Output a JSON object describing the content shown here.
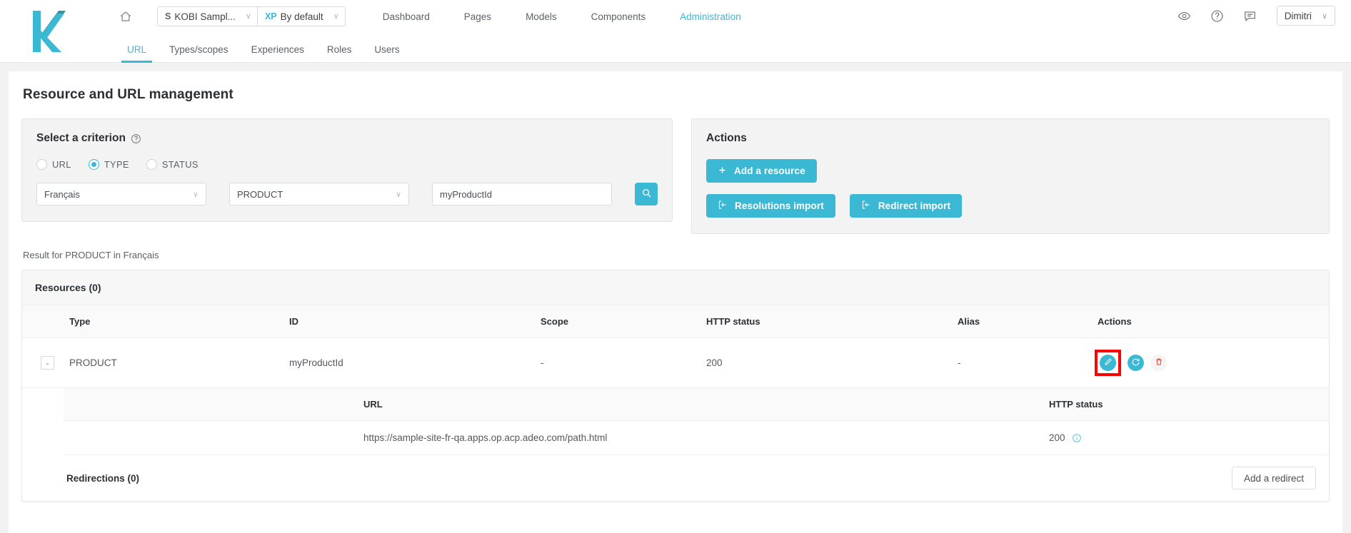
{
  "brand": {
    "logo_letter": "k",
    "accent": "#3bb9d4",
    "danger": "#f0372b"
  },
  "topbar": {
    "home_icon": "home-icon",
    "site_selector": {
      "tag": "S",
      "label": "KOBI Sampl...",
      "caret": "∨"
    },
    "experience_selector": {
      "tag": "XP",
      "label": "By default",
      "caret": "∨"
    },
    "nav": [
      {
        "label": "Dashboard",
        "active": false
      },
      {
        "label": "Pages",
        "active": false
      },
      {
        "label": "Models",
        "active": false
      },
      {
        "label": "Components",
        "active": false
      },
      {
        "label": "Administration",
        "active": true
      }
    ],
    "icons": [
      {
        "name": "eye-icon"
      },
      {
        "name": "help-circle-icon"
      },
      {
        "name": "feedback-icon"
      }
    ],
    "user": {
      "name": "Dimitri",
      "caret": "∨"
    }
  },
  "subnav": [
    {
      "label": "URL",
      "active": true
    },
    {
      "label": "Types/scopes",
      "active": false
    },
    {
      "label": "Experiences",
      "active": false
    },
    {
      "label": "Roles",
      "active": false
    },
    {
      "label": "Users",
      "active": false
    }
  ],
  "page": {
    "title": "Resource and URL management"
  },
  "criterion": {
    "heading": "Select a criterion",
    "help_icon": "help-circle-icon",
    "radios": [
      {
        "label": "URL",
        "checked": false
      },
      {
        "label": "TYPE",
        "checked": true
      },
      {
        "label": "STATUS",
        "checked": false
      }
    ],
    "language_select": {
      "value": "Français",
      "caret": "∨"
    },
    "type_select": {
      "value": "PRODUCT",
      "caret": "∨"
    },
    "id_input": {
      "value": "myProductId",
      "placeholder": "myProductId"
    },
    "search_button": {
      "icon": "search-icon",
      "label": ""
    }
  },
  "actions": {
    "heading": "Actions",
    "add_resource": {
      "label": "Add a resource",
      "icon": "plus-icon"
    },
    "resolutions_import": {
      "label": "Resolutions import",
      "icon": "import-icon"
    },
    "redirect_import": {
      "label": "Redirect import",
      "icon": "import-icon"
    }
  },
  "result": {
    "summary": "Result for PRODUCT in Français",
    "resources_heading": "Resources (0)",
    "columns": [
      "Type",
      "ID",
      "Scope",
      "HTTP status",
      "Alias",
      "Actions"
    ],
    "rows": [
      {
        "toggle": "-",
        "type": "PRODUCT",
        "id": "myProductId",
        "scope": "-",
        "http_status": "200",
        "alias": "-",
        "actions": [
          {
            "name": "edit-resource-button",
            "icon": "pencil-icon",
            "highlighted": true
          },
          {
            "name": "refresh-resource-button",
            "icon": "refresh-icon",
            "highlighted": false
          },
          {
            "name": "delete-resource-button",
            "icon": "trash-icon",
            "highlighted": false
          }
        ]
      }
    ],
    "url_table": {
      "columns": [
        "URL",
        "HTTP status"
      ],
      "rows": [
        {
          "url": "https://sample-site-fr-qa.apps.op.acp.adeo.com/path.html",
          "http_status": "200",
          "info_icon": "info-icon"
        }
      ]
    },
    "redirections": {
      "heading": "Redirections (0)",
      "add_button": "Add a redirect"
    }
  }
}
